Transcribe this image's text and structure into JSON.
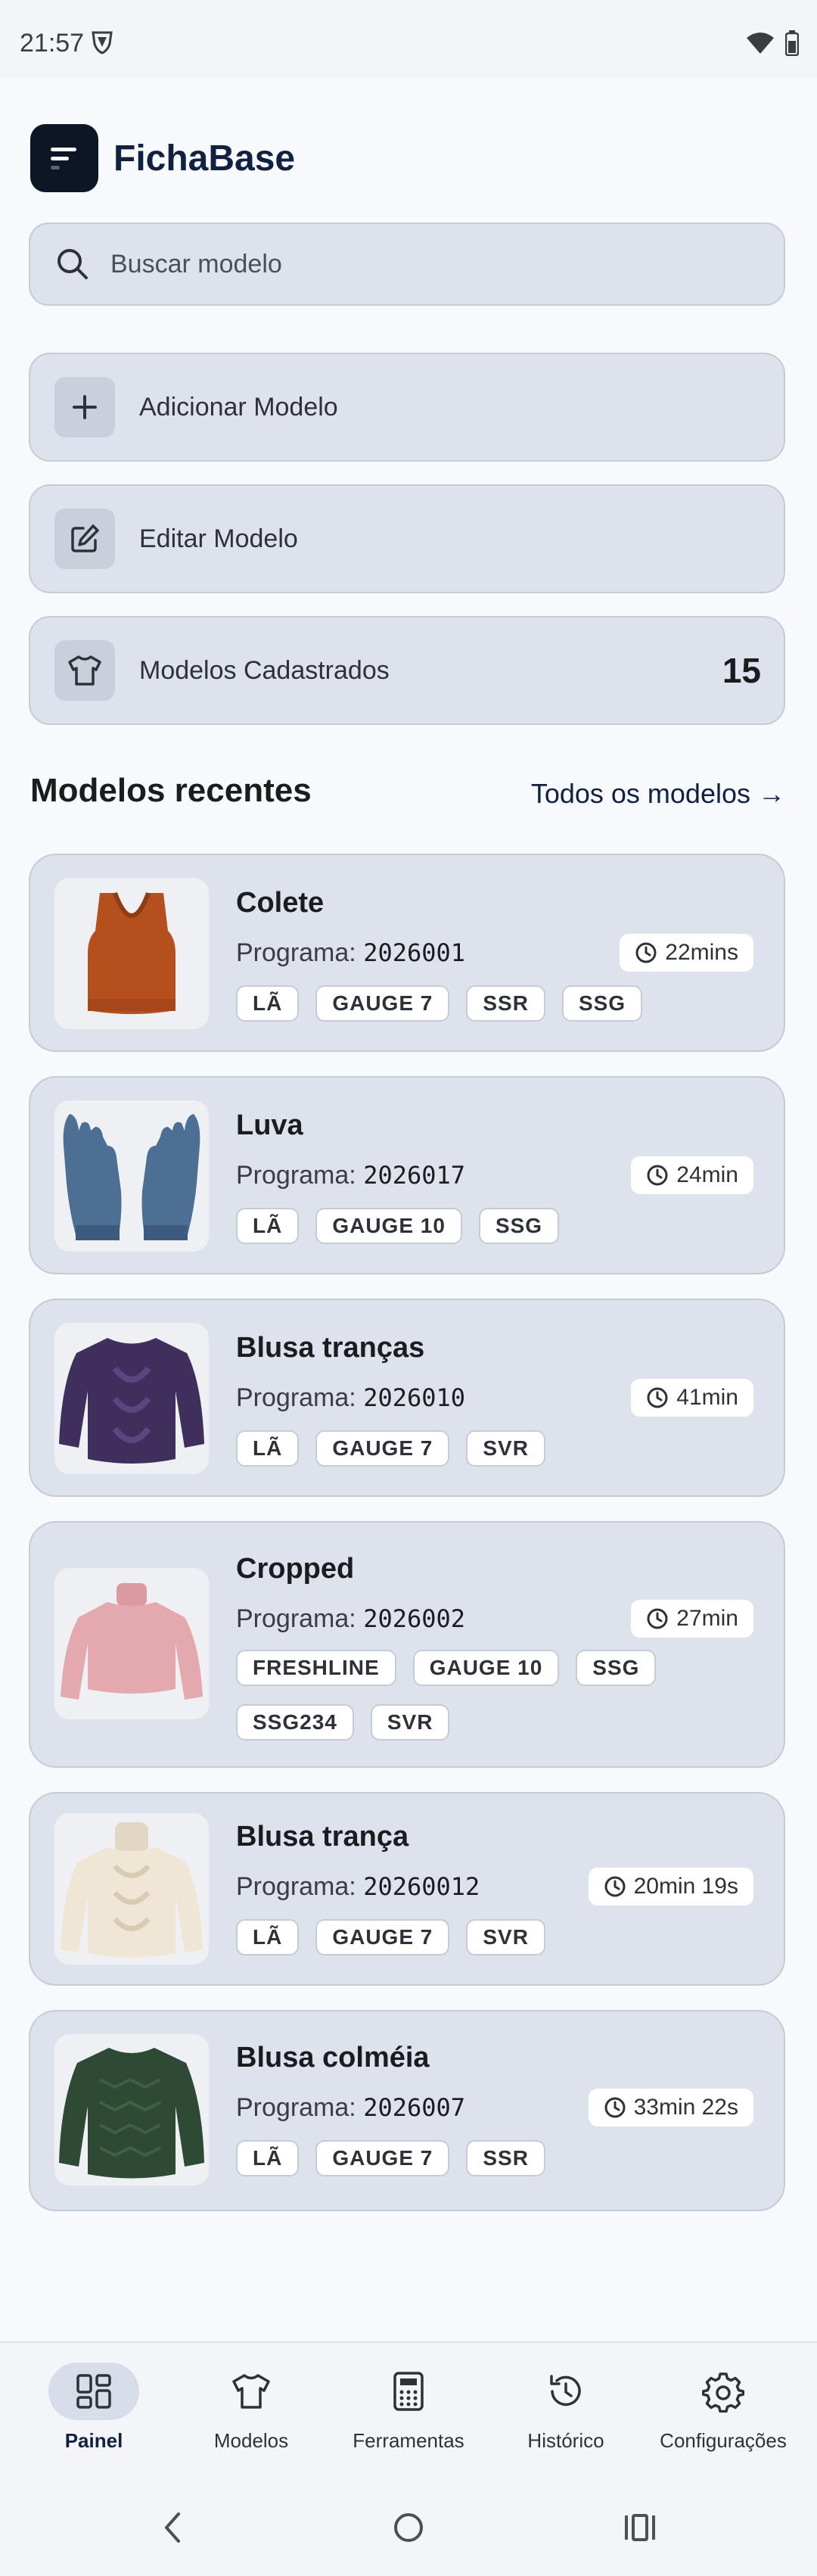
{
  "status_bar": {
    "time": "21:57"
  },
  "app": {
    "title": "FichaBase"
  },
  "search": {
    "placeholder": "Buscar modelo"
  },
  "actions": {
    "add_label": "Adicionar Modelo",
    "edit_label": "Editar Modelo",
    "registered_label": "Modelos Cadastrados",
    "registered_count": "15"
  },
  "recent": {
    "title": "Modelos recentes",
    "see_all": "Todos os modelos →",
    "program_prefix": "Programa:",
    "items": [
      {
        "name": "Colete",
        "program": "2026001",
        "time": "22mins",
        "tags": [
          "LÃ",
          "GAUGE 7",
          "SSR",
          "SSG"
        ],
        "icon": "sweater-vest-photo"
      },
      {
        "name": "Luva",
        "program": "2026017",
        "time": "24min",
        "tags": [
          "LÃ",
          "GAUGE 10",
          "SSG"
        ],
        "icon": "gloves-photo"
      },
      {
        "name": "Blusa tranças",
        "program": "2026010",
        "time": "41min",
        "tags": [
          "LÃ",
          "GAUGE 7",
          "SVR"
        ],
        "icon": "cable-sweater-photo"
      },
      {
        "name": "Cropped",
        "program": "2026002",
        "time": "27min",
        "tags": [
          "FRESHLINE",
          "GAUGE 10",
          "SSG",
          "SSG234",
          "SVR"
        ],
        "icon": "cropped-sweater-photo"
      },
      {
        "name": "Blusa trança",
        "program": "20260012",
        "time": "20min 19s",
        "tags": [
          "LÃ",
          "GAUGE 7",
          "SVR"
        ],
        "icon": "turtleneck-sweater-photo"
      },
      {
        "name": "Blusa colméia",
        "program": "2026007",
        "time": "33min 22s",
        "tags": [
          "LÃ",
          "GAUGE 7",
          "SSR"
        ],
        "icon": "honeycomb-sweater-photo"
      }
    ]
  },
  "bottom_nav": {
    "items": [
      {
        "label": "Painel",
        "icon": "dashboard-icon",
        "active": true
      },
      {
        "label": "Modelos",
        "icon": "shirt-icon",
        "active": false
      },
      {
        "label": "Ferramentas",
        "icon": "calculator-icon",
        "active": false
      },
      {
        "label": "Histórico",
        "icon": "history-icon",
        "active": false
      },
      {
        "label": "Configurações",
        "icon": "gear-icon",
        "active": false
      }
    ]
  },
  "colors": {
    "brand": "#112240",
    "card": "#dde2ec",
    "background": "#f8f9fd"
  }
}
